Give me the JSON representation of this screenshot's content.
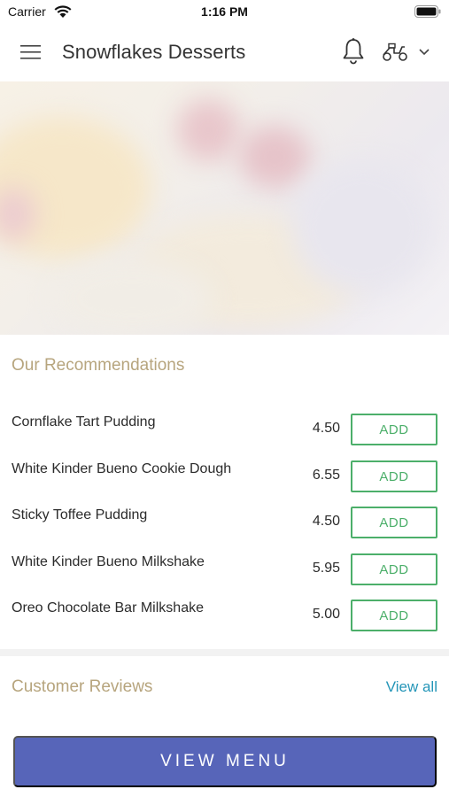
{
  "status_bar": {
    "carrier": "Carrier",
    "time": "1:16 PM"
  },
  "header": {
    "title": "Snowflakes Desserts"
  },
  "recommendations": {
    "title": "Our Recommendations",
    "items": [
      {
        "name": "Cornflake Tart Pudding",
        "price": "4.50",
        "add_label": "ADD"
      },
      {
        "name": "White Kinder Bueno Cookie Dough",
        "price": "6.55",
        "add_label": "ADD"
      },
      {
        "name": "Sticky Toffee Pudding",
        "price": "4.50",
        "add_label": "ADD"
      },
      {
        "name": "White Kinder Bueno Milkshake",
        "price": "5.95",
        "add_label": "ADD"
      },
      {
        "name": "Oreo Chocolate Bar Milkshake",
        "price": "5.00",
        "add_label": "ADD"
      }
    ]
  },
  "reviews": {
    "title": "Customer Reviews",
    "view_all": "View all"
  },
  "footer": {
    "view_menu": "VIEW MENU"
  },
  "colors": {
    "accent_gold": "#b7a57e",
    "add_green": "#4caf6a",
    "link_blue": "#2596b8",
    "primary_button": "#5765b9"
  }
}
